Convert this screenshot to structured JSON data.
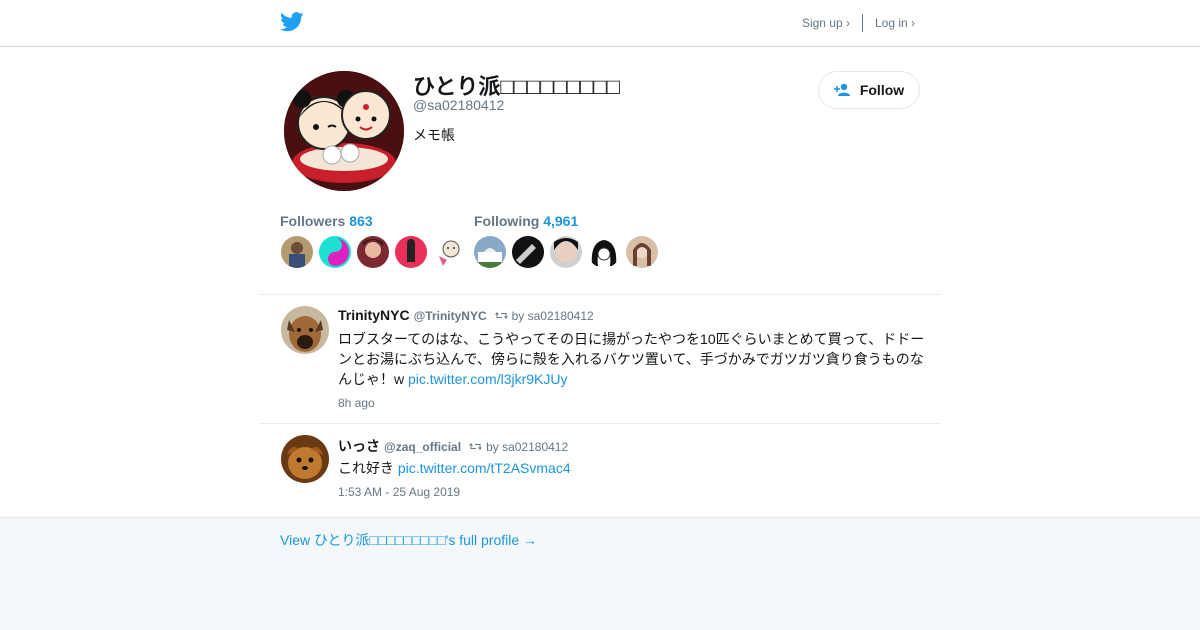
{
  "header": {
    "signup_label": "Sign up ›",
    "login_label": "Log in ›"
  },
  "profile": {
    "display_name": "ひとり派□□□□□□□□□",
    "screen_name": "@sa02180412",
    "bio": "メモ帳",
    "follow_label": "Follow",
    "followers_label": "Followers",
    "followers_count": "863",
    "following_label": "Following",
    "following_count": "4,961"
  },
  "colors": {
    "accent": "#1b95e0",
    "text": "#14171a",
    "muted": "#657786",
    "footer_bg": "#f5f8fa"
  },
  "tweets": [
    {
      "name": "TrinityNYC",
      "handle": "@TrinityNYC",
      "retweeted_by": "by sa02180412",
      "text": "ロブスターてのはな、こうやってその日に揚がったやつを10匹ぐらいまとめて買って、ドドーンとお湯にぶち込んで、傍らに殻を入れるバケツ置いて、手づかみでガツガツ貪り食うものなんじゃ！w ",
      "link": "pic.twitter.com/l3jkr9KJUy",
      "time": "8h ago"
    },
    {
      "name": "いっさ",
      "handle": "@zaq_official",
      "retweeted_by": "by sa02180412",
      "text": "これ好き ",
      "link": "pic.twitter.com/tT2ASvmac4",
      "time": "1:53 AM - 25 Aug 2019"
    }
  ],
  "footer": {
    "full_profile_label": "View ひとり派□□□□□□□□□'s full profile →"
  }
}
